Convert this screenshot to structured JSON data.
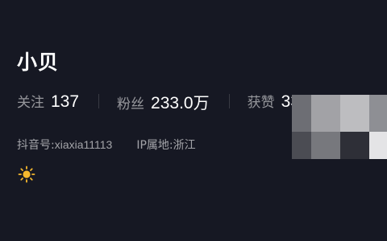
{
  "profile": {
    "name": "小贝",
    "stats": [
      {
        "label": "关注",
        "value": "137"
      },
      {
        "label": "粉丝",
        "value": "233.0",
        "unit": "万"
      },
      {
        "label": "获赞",
        "value": "3380"
      }
    ],
    "douyin_id_label": "抖音号:",
    "douyin_id_value": "xiaxia11113",
    "ip_label": "IP属地:",
    "ip_value": "浙江",
    "sun_icon_color": "#f5b82e"
  },
  "colors": {
    "background": "#161823",
    "text_primary": "#ffffff",
    "text_secondary": "#8a8b91"
  }
}
